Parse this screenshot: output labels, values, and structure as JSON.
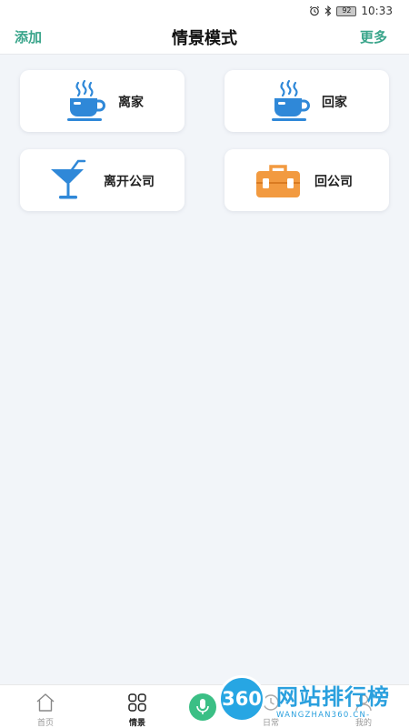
{
  "status_bar": {
    "battery": "92",
    "time": "10:33",
    "icons": [
      "alarm-icon",
      "bluetooth-icon",
      "battery-icon"
    ]
  },
  "header": {
    "add": "添加",
    "title": "情景模式",
    "more": "更多"
  },
  "scenes": [
    {
      "label": "离家",
      "icon": "coffee-cup-icon"
    },
    {
      "label": "回家",
      "icon": "coffee-cup-icon"
    },
    {
      "label": "离开公司",
      "icon": "cocktail-glass-icon"
    },
    {
      "label": "回公司",
      "icon": "toolbox-icon"
    }
  ],
  "nav": [
    {
      "label": "首页",
      "icon": "home-icon"
    },
    {
      "label": "情景",
      "icon": "grid-icon"
    },
    {
      "label": "日常",
      "icon": "daily-icon"
    },
    {
      "label": "我的",
      "icon": "profile-icon"
    }
  ],
  "voice": {
    "icon": "microphone-icon"
  },
  "watermark": {
    "badge": "360",
    "title": "网站排行榜",
    "subtitle": "WANGZHAN360.CN-"
  },
  "colors": {
    "accent_green": "#3aa58b",
    "cup_blue": "#2f88d8",
    "toolbox_orange": "#f29a40",
    "background": "#f2f5f9",
    "watermark_blue": "#27a6e3"
  }
}
